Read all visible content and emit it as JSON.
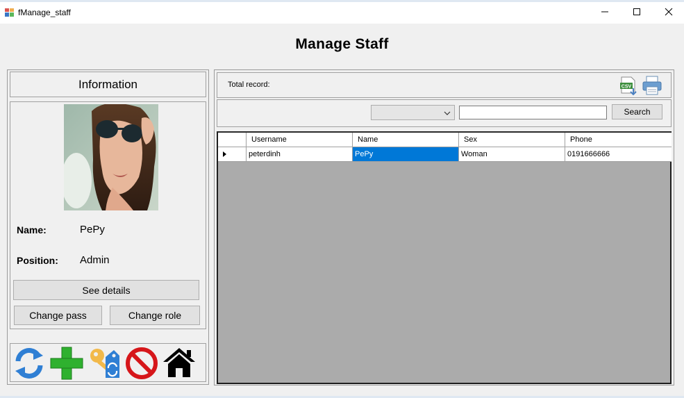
{
  "window": {
    "title": "fManage_staff"
  },
  "form": {
    "title": "Manage Staff"
  },
  "info_panel": {
    "header": "Information",
    "name_label": "Name:",
    "name_value": "PePy",
    "position_label": "Position:",
    "position_value": "Admin",
    "see_details": "See details",
    "change_pass": "Change pass",
    "change_role": "Change role"
  },
  "toolbar_icons": [
    "refresh-icon",
    "add-icon",
    "key-reset-icon",
    "ban-icon",
    "home-icon"
  ],
  "records": {
    "total_label": "Total record:",
    "csv_badge": "CSV"
  },
  "search": {
    "filter_value": "",
    "query_value": "",
    "button": "Search"
  },
  "grid": {
    "columns": [
      "Username",
      "Name",
      "Sex",
      "Phone"
    ],
    "rows": [
      {
        "username": "peterdinh",
        "name": "PePy",
        "sex": "Woman",
        "phone": "0191666666"
      }
    ],
    "selected_cell": "name",
    "colors": {
      "selection": "#0078d7",
      "empty_area": "#ababab"
    }
  }
}
